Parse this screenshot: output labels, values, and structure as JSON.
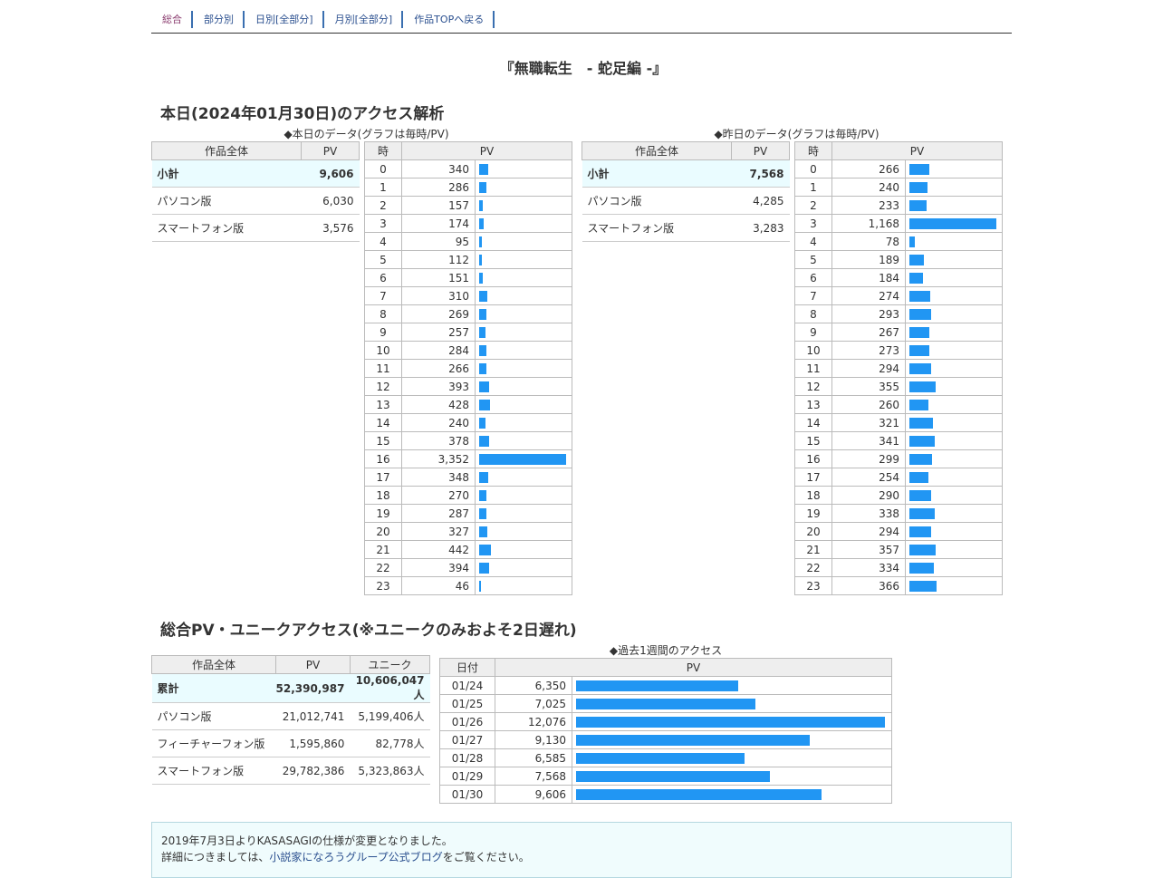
{
  "nav": [
    "総合",
    "部分別",
    "日別[全部分]",
    "月別[全部分]",
    "作品TOPへ戻る"
  ],
  "work_title": "『無職転生　- 蛇足編 -』",
  "today_heading": "本日(2024年01月30日)のアクセス解析",
  "today_caption": "◆本日のデータ(グラフは毎時/PV)",
  "yesterday_caption": "◆昨日のデータ(グラフは毎時/PV)",
  "summary_headers": {
    "label": "作品全体",
    "pv": "PV"
  },
  "hour_headers": {
    "hour": "時",
    "pv": "PV"
  },
  "today_summary": [
    {
      "label": "小計",
      "pv": "9,606"
    },
    {
      "label": "パソコン版",
      "pv": "6,030"
    },
    {
      "label": "スマートフォン版",
      "pv": "3,576"
    }
  ],
  "yesterday_summary": [
    {
      "label": "小計",
      "pv": "7,568"
    },
    {
      "label": "パソコン版",
      "pv": "4,285"
    },
    {
      "label": "スマートフォン版",
      "pv": "3,283"
    }
  ],
  "today_hourly": [
    340,
    286,
    157,
    174,
    95,
    112,
    151,
    310,
    269,
    257,
    284,
    266,
    393,
    428,
    240,
    378,
    3352,
    348,
    270,
    287,
    327,
    442,
    394,
    46
  ],
  "yesterday_hourly": [
    266,
    240,
    233,
    1168,
    78,
    189,
    184,
    274,
    293,
    267,
    273,
    294,
    355,
    260,
    321,
    341,
    299,
    254,
    290,
    338,
    294,
    357,
    334,
    366
  ],
  "total_heading": "総合PV・ユニークアクセス(※ユニークのみおよそ2日遅れ)",
  "total_headers": {
    "label": "作品全体",
    "pv": "PV",
    "unique": "ユニーク"
  },
  "total_summary": [
    {
      "label": "累計",
      "pv": "52,390,987",
      "unique": "10,606,047人"
    },
    {
      "label": "パソコン版",
      "pv": "21,012,741",
      "unique": "5,199,406人"
    },
    {
      "label": "フィーチャーフォン版",
      "pv": "1,595,860",
      "unique": "82,778人"
    },
    {
      "label": "スマートフォン版",
      "pv": "29,782,386",
      "unique": "5,323,863人"
    }
  ],
  "week_caption": "◆過去1週間のアクセス",
  "week_headers": {
    "date": "日付",
    "pv": "PV"
  },
  "week": [
    {
      "date": "01/24",
      "pv": 6350
    },
    {
      "date": "01/25",
      "pv": 7025
    },
    {
      "date": "01/26",
      "pv": 12076
    },
    {
      "date": "01/27",
      "pv": 9130
    },
    {
      "date": "01/28",
      "pv": 6585
    },
    {
      "date": "01/29",
      "pv": 7568
    },
    {
      "date": "01/30",
      "pv": 9606
    }
  ],
  "notice": {
    "line1": "2019年7月3日よりKASASAGIの仕様が変更となりました。",
    "line2_prefix": "詳細につきましては、",
    "line2_link": "小説家になろうグループ公式ブログ",
    "line2_suffix": "をご覧ください。"
  },
  "colors": {
    "bar": "#2196f3",
    "subtotal_bg": "#eafcff",
    "header_bg": "#eeeeee",
    "nav_active": "#8a3b6e",
    "nav_link": "#2a4f8f"
  }
}
